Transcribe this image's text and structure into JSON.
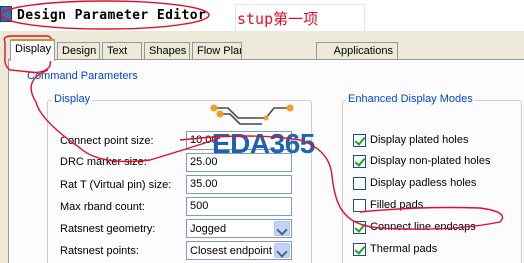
{
  "window": {
    "title": "Design Parameter Editor",
    "annotation": "stup第一项"
  },
  "tabs": [
    {
      "label": "Display",
      "active": true
    },
    {
      "label": "Design"
    },
    {
      "label": "Text"
    },
    {
      "label": "Shapes"
    },
    {
      "label": "Flow Planning"
    },
    {
      "label": "Applications"
    }
  ],
  "section": {
    "legend": "Command Parameters"
  },
  "display_group": {
    "legend": "Display",
    "fields": [
      {
        "label": "Connect point size:",
        "value": "10.00"
      },
      {
        "label": "DRC marker size:",
        "value": "25.00"
      },
      {
        "label": "Rat T (Virtual pin) size:",
        "value": "35.00"
      },
      {
        "label": "Max rband count:",
        "value": "500"
      },
      {
        "label": "Ratsnest geometry:",
        "value": "Jogged"
      },
      {
        "label": "Ratsnest points:",
        "value": "Closest endpoint"
      }
    ]
  },
  "enhanced_group": {
    "legend": "Enhanced Display Modes",
    "options": [
      {
        "label": "Display plated holes",
        "checked": true
      },
      {
        "label": "Display non-plated holes",
        "checked": true
      },
      {
        "label": "Display padless holes",
        "checked": false
      },
      {
        "label": "Filled pads",
        "checked": false
      },
      {
        "label": "Connect line endcaps",
        "checked": true
      },
      {
        "label": "Thermal pads",
        "checked": true
      }
    ]
  },
  "watermark": {
    "text": "EDA365"
  },
  "colors": {
    "accent_tab": "#e68b2c",
    "legend_blue": "#0046d5",
    "annotation_red": "#e0102a",
    "watermark_blue": "#1e63b3",
    "logo_orange": "#f0a020"
  }
}
